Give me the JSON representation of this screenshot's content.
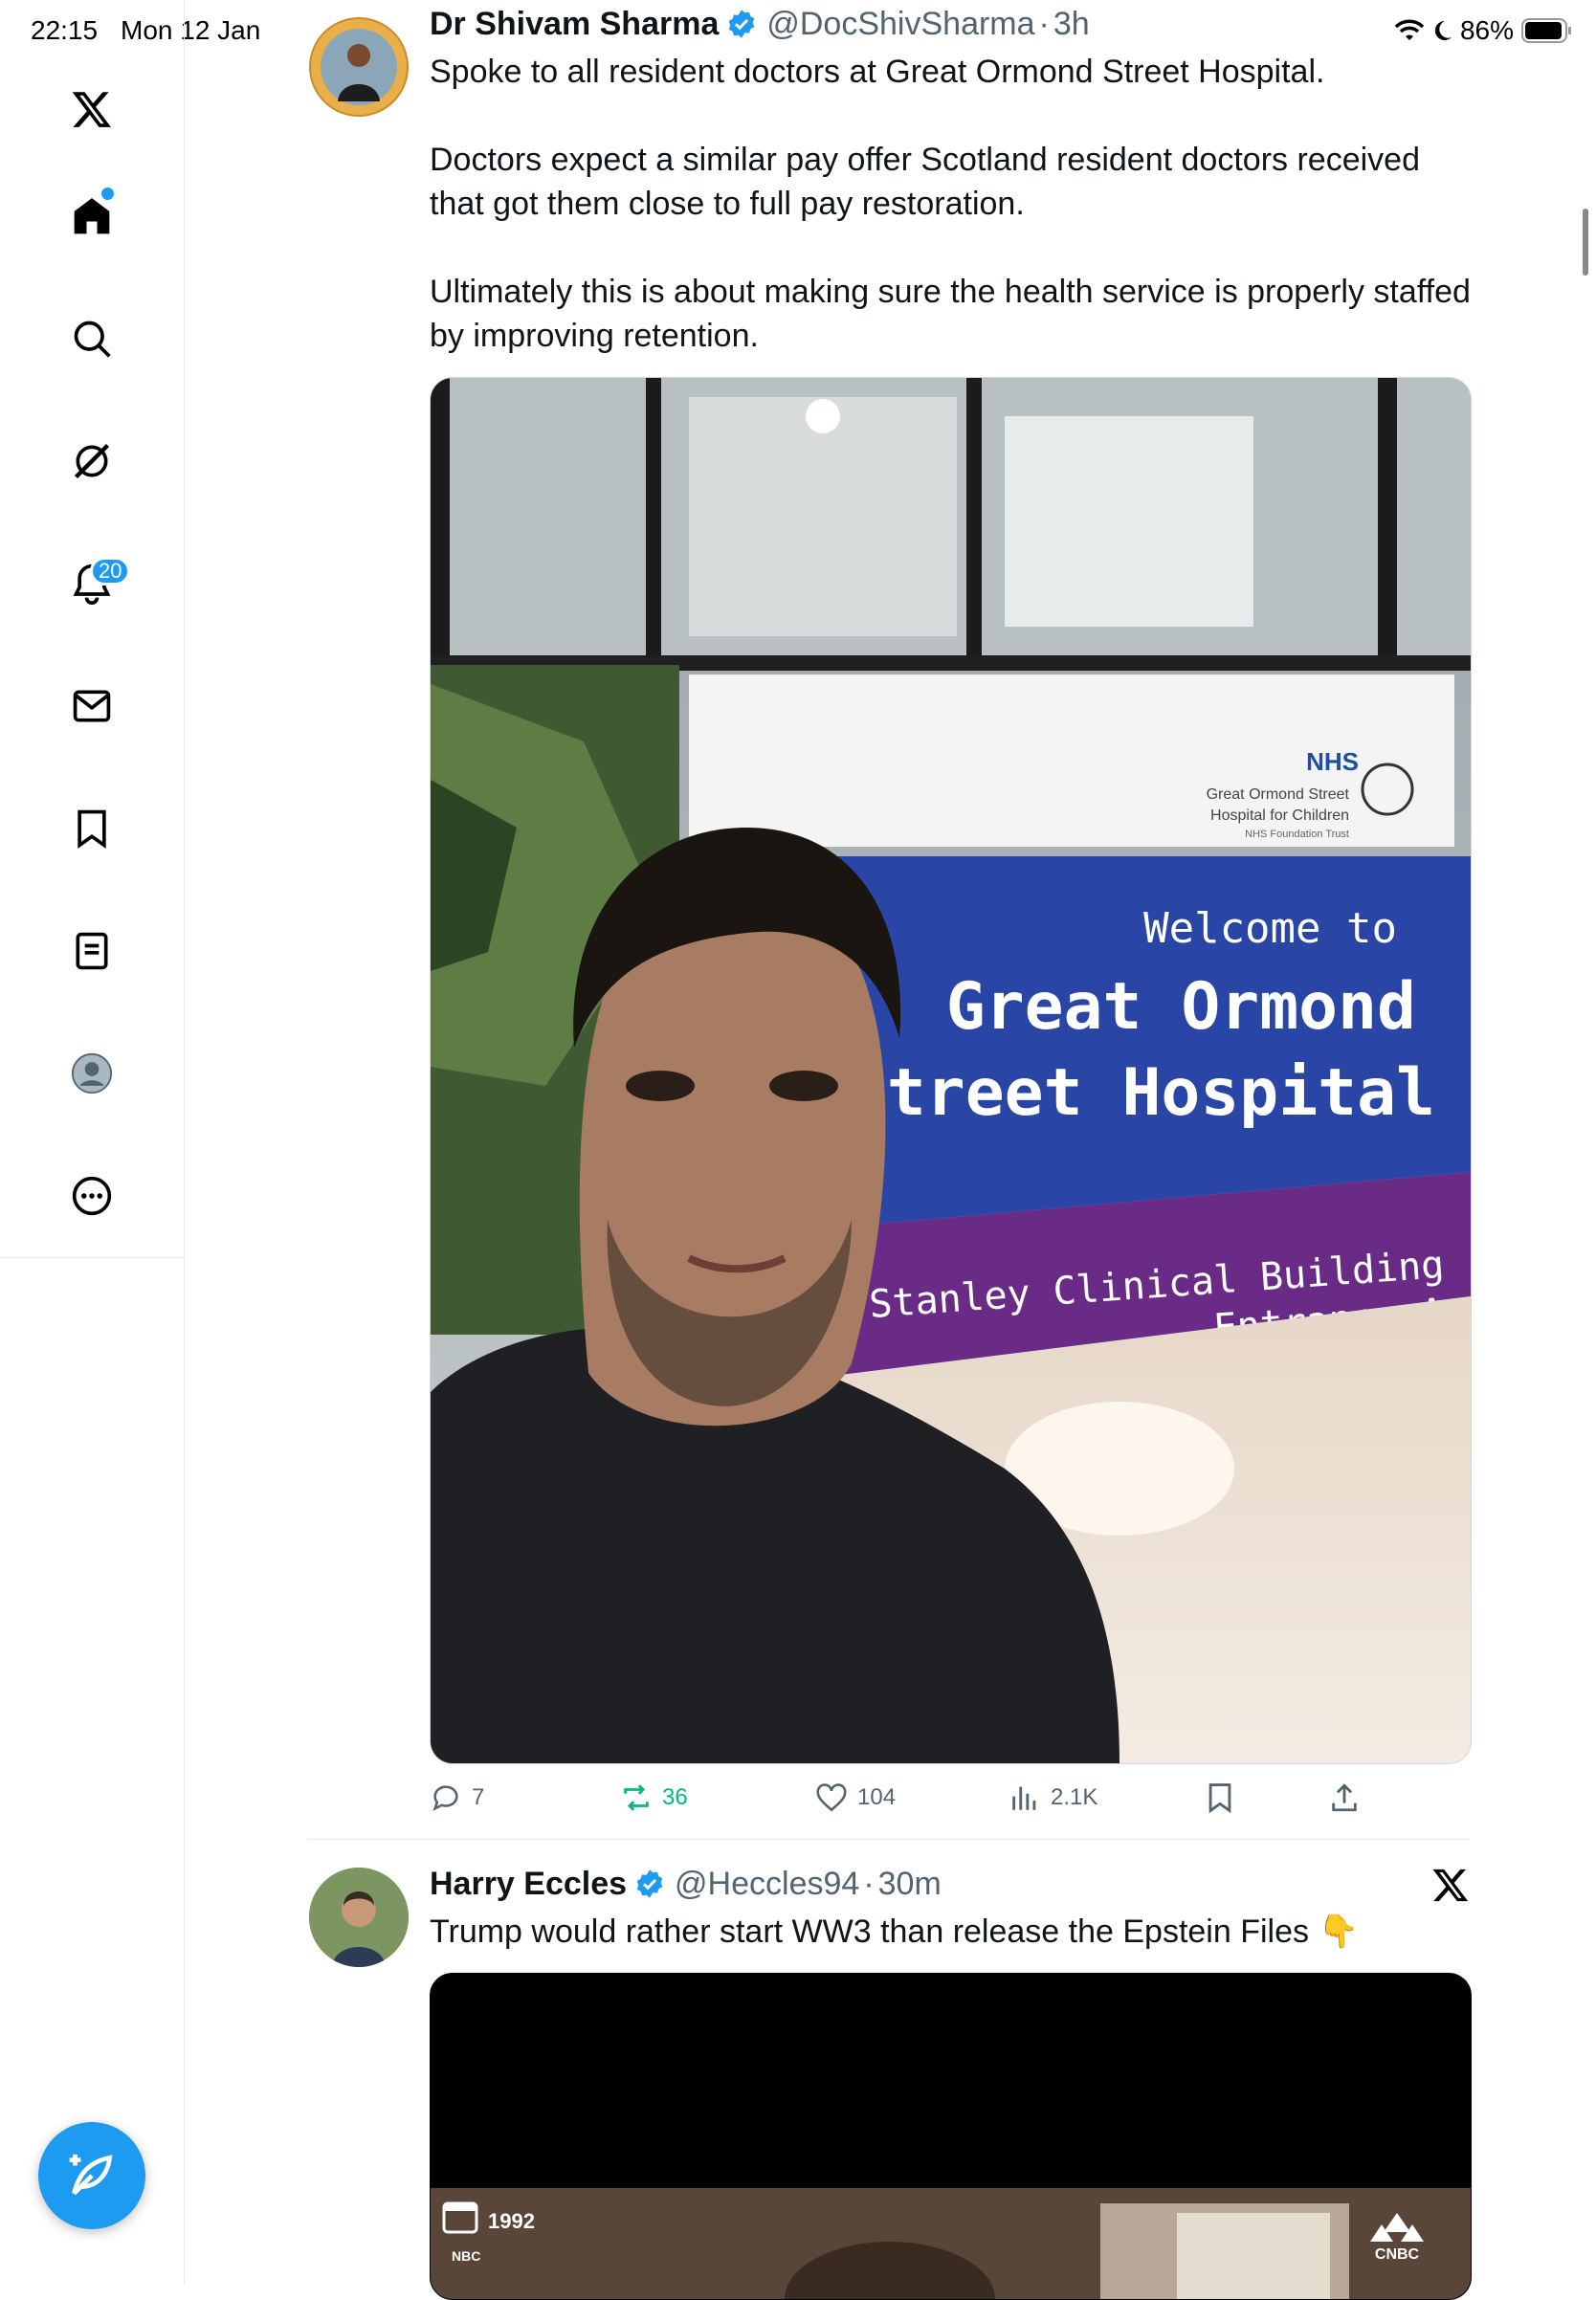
{
  "status_bar": {
    "time": "22:15",
    "date": "Mon 12 Jan",
    "battery": "86%"
  },
  "sidebar": {
    "items": [
      {
        "name": "home",
        "icon": "home-icon"
      },
      {
        "name": "explore",
        "icon": "search-icon"
      },
      {
        "name": "grok",
        "icon": "grok-icon"
      },
      {
        "name": "notifications",
        "icon": "bell-icon",
        "badge": "20"
      },
      {
        "name": "messages",
        "icon": "envelope-icon"
      },
      {
        "name": "bookmarks",
        "icon": "bookmark-icon"
      },
      {
        "name": "lists",
        "icon": "list-icon"
      },
      {
        "name": "profile",
        "icon": "profile-icon"
      },
      {
        "name": "more",
        "icon": "more-icon"
      }
    ],
    "notifications_badge": "20",
    "compose_icon": "compose-icon"
  },
  "tweets": [
    {
      "name": "Dr Shivam Sharma",
      "handle": "@DocShivSharma",
      "separator": "·",
      "time": "3h",
      "verified": true,
      "text": "Spoke to all resident doctors at Great Ormond Street Hospital.\n\nDoctors expect a similar pay offer Scotland resident doctors received that got them close to full pay restoration.\n\nUltimately this is about making sure the health service is properly staffed by improving retention.",
      "image": {
        "sign_nhs": "NHS",
        "sign_org_line1": "Great Ormond Street",
        "sign_org_line2": "Hospital for Children",
        "sign_org_line3": "NHS Foundation Trust",
        "sign_welcome": "Welcome to",
        "sign_title_line1": "Great Ormond",
        "sign_title_line2": "Street Hospital",
        "sign_building_line1": "Morgan Stanley Clinical Building",
        "sign_building_line2": "Entrance A"
      },
      "stats": {
        "replies": "7",
        "reposts": "36",
        "likes": "104",
        "views": "2.1K"
      }
    },
    {
      "name": "Harry Eccles",
      "handle": "@Heccles94",
      "separator": "·",
      "time": "30m",
      "verified": true,
      "text": "Trump would rather start WW3 than release the Epstein Files 👇",
      "video": {
        "year_label": "1992",
        "network_label": "NBC",
        "channel_label": "CNBC"
      }
    }
  ],
  "colors": {
    "accent": "#1d9bf0",
    "repost_green": "#00ba7c",
    "text_primary": "#0f1419",
    "text_secondary": "#536471"
  }
}
